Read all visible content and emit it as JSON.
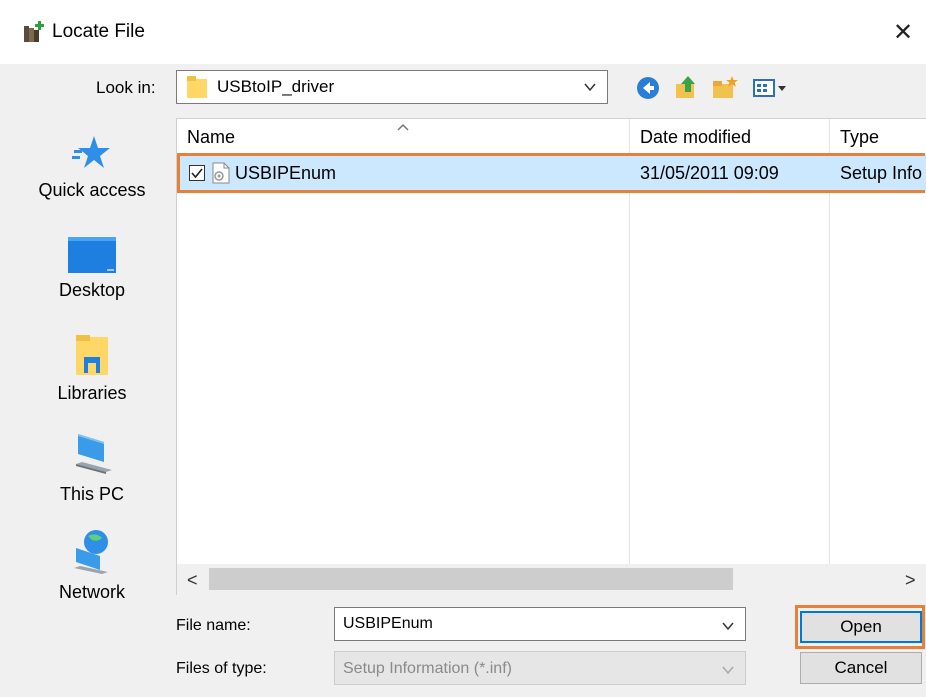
{
  "window": {
    "title": "Locate File",
    "close_symbol": "✕"
  },
  "toolbar": {
    "lookin_label": "Look in:",
    "lookin_value": "USBtoIP_driver",
    "icons": [
      "back-icon",
      "up-folder-icon",
      "new-folder-icon",
      "view-menu-icon"
    ]
  },
  "sidebar": {
    "items": [
      {
        "label": "Quick access",
        "icon": "quick-access-star-icon"
      },
      {
        "label": "Desktop",
        "icon": "desktop-icon"
      },
      {
        "label": "Libraries",
        "icon": "libraries-icon"
      },
      {
        "label": "This PC",
        "icon": "this-pc-icon"
      },
      {
        "label": "Network",
        "icon": "network-icon"
      }
    ]
  },
  "filelist": {
    "columns": [
      "Name",
      "Date modified",
      "Type"
    ],
    "rows": [
      {
        "name": "USBIPEnum",
        "date_modified": "31/05/2011 09:09",
        "type": "Setup Info",
        "checked": true,
        "selected": true
      }
    ],
    "scroll_left": "<",
    "scroll_right": ">"
  },
  "footer": {
    "file_name_label": "File name:",
    "file_name_value": "USBIPEnum",
    "files_of_type_label": "Files of type:",
    "files_of_type_value": "Setup Information (*.inf)",
    "open_label": "Open",
    "cancel_label": "Cancel"
  },
  "colors": {
    "selection": "#cce8ff",
    "highlight_outline": "#e8803a",
    "accent": "#0078d7"
  }
}
